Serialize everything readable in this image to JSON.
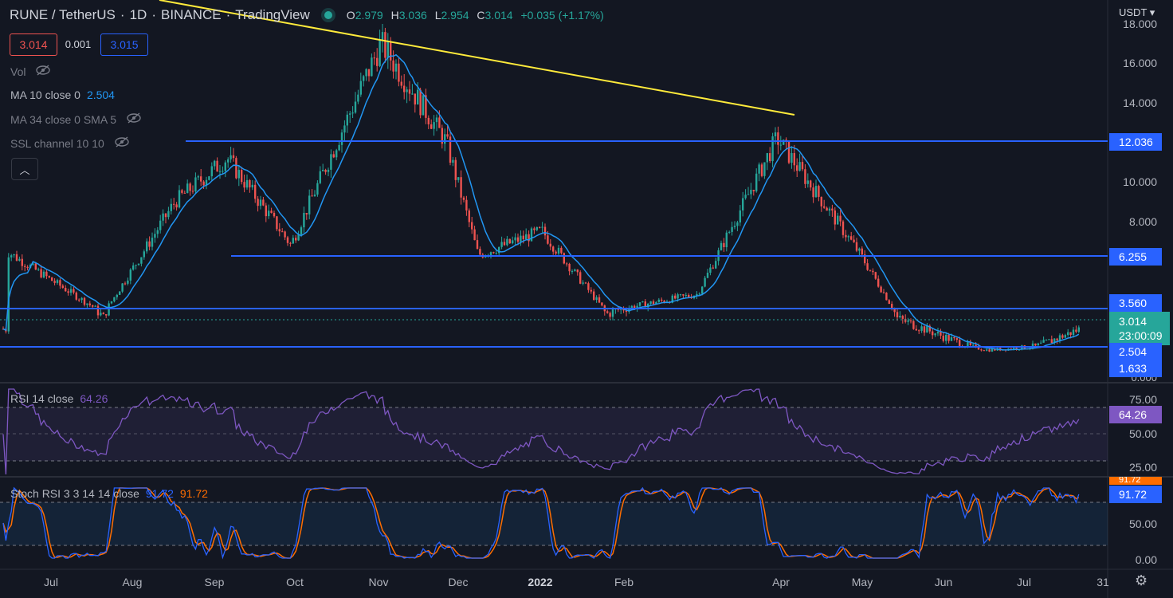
{
  "header": {
    "symbol": "RUNE / TetherUS",
    "interval": "1D",
    "exchange": "BINANCE",
    "brand": "TradingView",
    "o_label": "O",
    "o": "2.979",
    "h_label": "H",
    "h": "3.036",
    "l_label": "L",
    "l": "2.954",
    "c_label": "C",
    "c": "3.014",
    "change": "+0.035 (+1.17%)"
  },
  "trade": {
    "sell": "3.014",
    "spread": "0.001",
    "buy": "3.015"
  },
  "indicators": {
    "vol": "Vol",
    "ma10_label": "MA 10 close 0",
    "ma10_value": "2.504",
    "ma34_label": "MA 34 close 0 SMA 5",
    "ssl_label": "SSL channel 10 10"
  },
  "currency": "USDT",
  "y_axis": [
    "18.000",
    "16.000",
    "14.000",
    "12.000",
    "10.000",
    "8.000",
    "0.000"
  ],
  "price_tags": {
    "r1": "12.036",
    "r2": "6.255",
    "r3": "3.560",
    "last": "3.014",
    "countdown": "23:00:09",
    "ma": "2.504",
    "s1": "1.633"
  },
  "rsi": {
    "label": "RSI 14 close",
    "value": "64.26",
    "axis": [
      "75.00",
      "50.00",
      "25.00"
    ],
    "tag": "64.26"
  },
  "stoch": {
    "label": "Stoch RSI 3 3 14 14 close",
    "k": "91.72",
    "d": "91.72",
    "axis": [
      "50.00",
      "0.00"
    ],
    "tag": "91.72",
    "tag2": "91.72"
  },
  "x_axis": [
    "Jul",
    "Aug",
    "Sep",
    "Oct",
    "Nov",
    "Dec",
    "2022",
    "Feb",
    "Apr",
    "May",
    "Jun",
    "Jul",
    "31"
  ],
  "colors": {
    "up": "#26a69a",
    "down": "#ef5350",
    "level": "#2962ff",
    "trend": "#ffeb3b",
    "ma": "#2196f3",
    "rsi": "#7e57c2",
    "stoch_d": "#ff6d00"
  },
  "chart_data": {
    "type": "candlestick",
    "horizontal_levels": [
      12.036,
      6.255,
      3.56,
      1.633
    ],
    "trendline": {
      "from_price": 17.3,
      "to_price": 13.4,
      "from_label": "Nov",
      "to_label": "Apr"
    },
    "price_path": [
      {
        "x": "Jul",
        "y": 6.5
      },
      {
        "x": "Aug",
        "y": 3.3
      },
      {
        "x": "Aug",
        "y": 9.0
      },
      {
        "x": "Sep",
        "y": 11.2
      },
      {
        "x": "Oct",
        "y": 6.8
      },
      {
        "x": "Nov",
        "y": 17.0
      },
      {
        "x": "Dec",
        "y": 12.0
      },
      {
        "x": "Dec",
        "y": 6.3
      },
      {
        "x": "2022",
        "y": 7.5
      },
      {
        "x": "Feb",
        "y": 3.4
      },
      {
        "x": "Feb",
        "y": 4.3
      },
      {
        "x": "Apr",
        "y": 12.2
      },
      {
        "x": "May",
        "y": 6.3
      },
      {
        "x": "May",
        "y": 3.3
      },
      {
        "x": "Jun",
        "y": 2.3
      },
      {
        "x": "Jul",
        "y": 2.5
      },
      {
        "x": "Jul",
        "y": 3.0
      }
    ]
  }
}
